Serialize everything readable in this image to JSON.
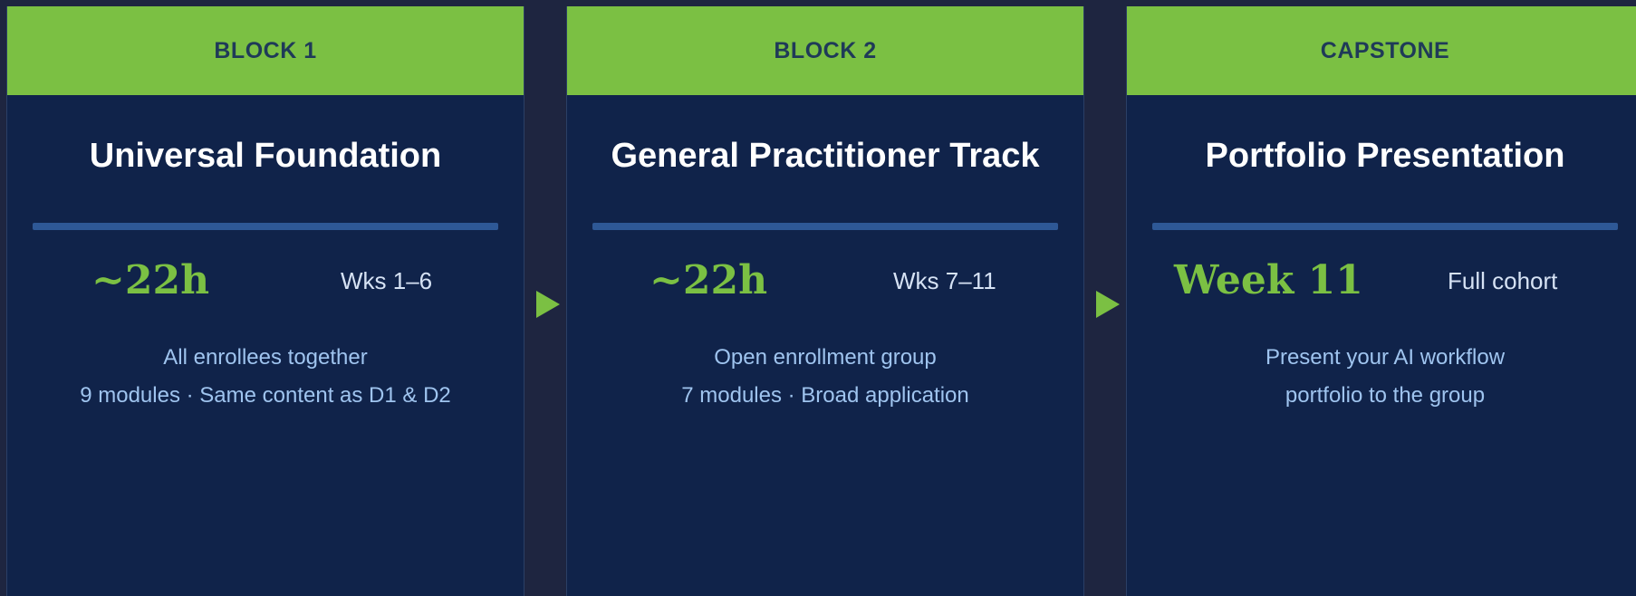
{
  "blocks": [
    {
      "header": "BLOCK 1",
      "title": "Universal Foundation",
      "stat": "~22h",
      "schedule": "Wks 1–6",
      "lines": [
        "All enrollees together",
        "9 modules · Same content as D1 & D2"
      ]
    },
    {
      "header": "BLOCK 2",
      "title": "General Practitioner Track",
      "stat": "~22h",
      "schedule": "Wks 7–11",
      "lines": [
        "Open enrollment group",
        "7 modules · Broad application"
      ]
    },
    {
      "header": "CAPSTONE",
      "title": "Portfolio Presentation",
      "stat": "Week 11",
      "schedule": "Full cohort",
      "lines": [
        "Present your AI workflow",
        "portfolio to the group"
      ]
    }
  ],
  "icons": {
    "arrow": "play-arrow-icon"
  },
  "colors": {
    "background": "#1e2540",
    "card": "#10234a",
    "accent_green": "#7bc043",
    "rule_blue": "#2e5896",
    "header_text": "#1f3a58",
    "desc_text": "#9fc4ef"
  }
}
